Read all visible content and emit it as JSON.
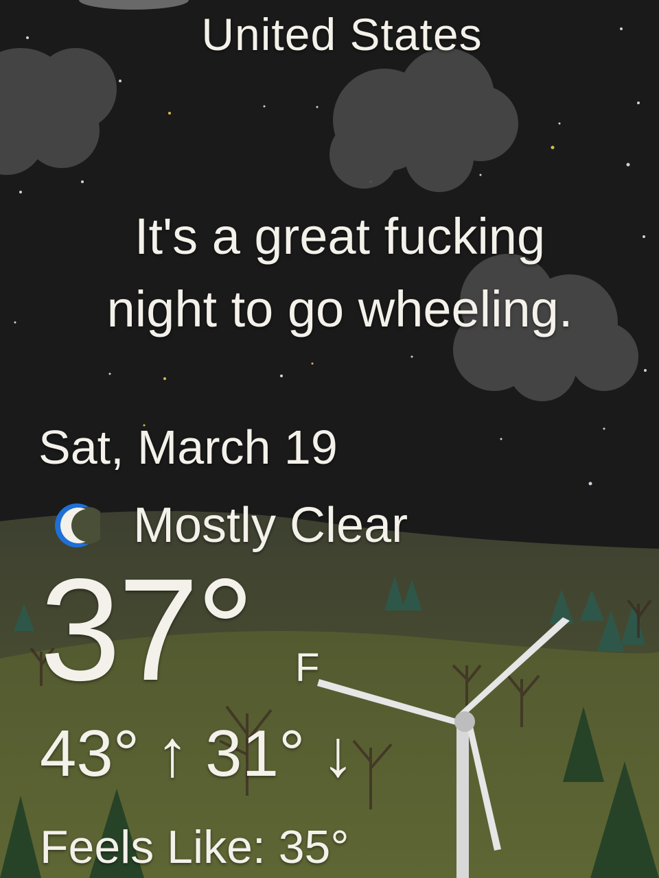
{
  "location": {
    "name": "United States"
  },
  "headline": {
    "line1": "It's a great fucking",
    "line2": "night to go wheeling."
  },
  "forecast": {
    "date": "Sat, March 19",
    "condition": "Mostly Clear",
    "condition_icon": "crescent-moon-icon",
    "temperature": "37°",
    "unit": "F",
    "high": "43°",
    "high_arrow": "↑",
    "low": "31°",
    "low_arrow": "↓",
    "feels_like_label": "Feels Like:",
    "feels_like_value": "35°"
  },
  "colors": {
    "sky": "#1a1a1a",
    "cloud": "#4a4a4a",
    "hill": "#4d5234",
    "moon_icon": "#1f6fd6",
    "text": "#f3f1ea"
  }
}
